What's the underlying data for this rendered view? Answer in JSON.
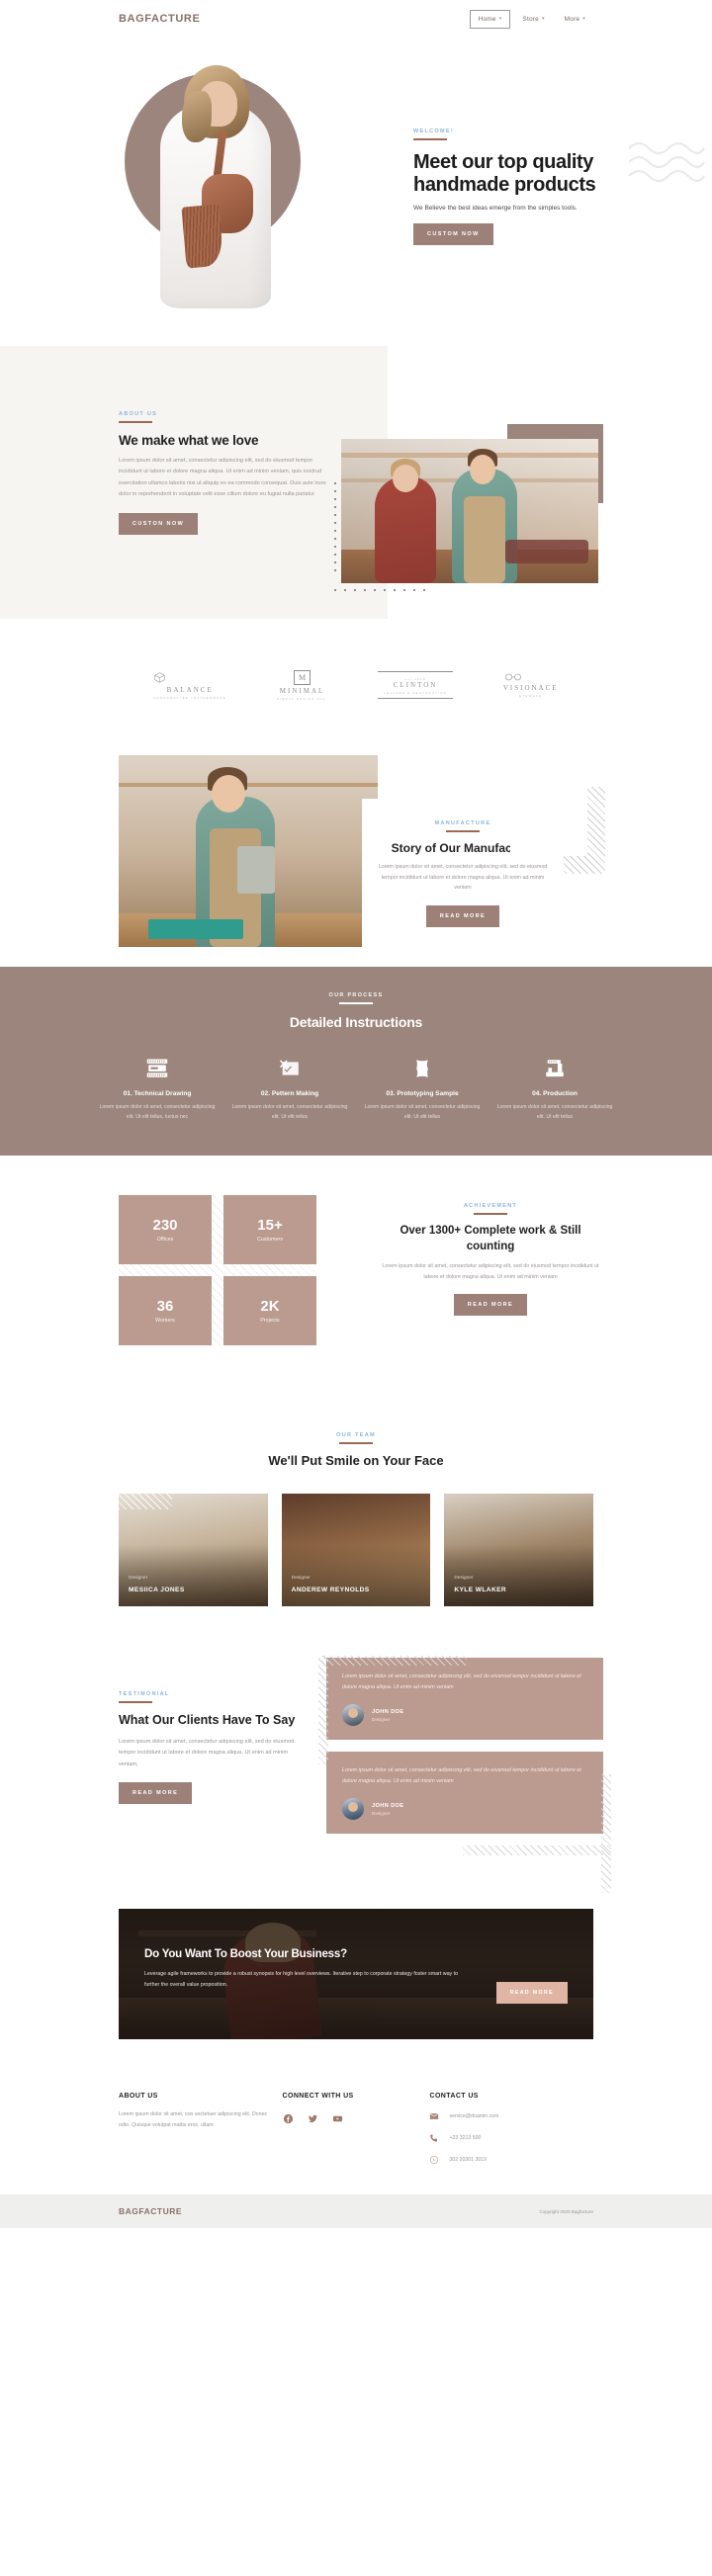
{
  "site": {
    "brand": "BAGFACTURE"
  },
  "header": {
    "nav": [
      {
        "label": "Home",
        "caret": "chevron-down-icon",
        "active": true
      },
      {
        "label": "Store",
        "caret": "chevron-down-icon",
        "active": false
      },
      {
        "label": "More",
        "caret": "chevron-down-icon",
        "active": false
      }
    ]
  },
  "hero": {
    "eyebrow": "WELCOME!",
    "title": "Meet our top quality handmade products",
    "subtitle": "We Believe the best ideas emerge from the simples tools.",
    "button": "CUSTOM NOW"
  },
  "about": {
    "eyebrow": "ABOUT US",
    "title": "We make what we love",
    "text": "Lorem ipsum dolor sit amet, consectetur adipiscing elit, sed do eiusmod tempor incididunt ut labore et dolore magna aliqua. Ut enim ad minim veniam, quis nostrud exercitation ullamco laboris nisi ut aliquip ex ea commodo consequat. Duis aute irure dolor in reprehenderit in voluptate velit esse cillum dolore eu fugiat nulla pariatur",
    "button": "CUSTON NOW"
  },
  "logos": [
    {
      "name": "BALANCE",
      "sub": "HANDCRAFTED LEATHERWARE",
      "mark": "cube-icon"
    },
    {
      "name": "MINIMAL",
      "sub": "SIMPLY DESIGN INC.",
      "mark": "m-monogram-icon"
    },
    {
      "name": "CLINTON",
      "sub": "LEATHER & RESTORATION",
      "mark": "est-2020"
    },
    {
      "name": "VISIONACE",
      "sub": "EYEWEAR",
      "mark": "glasses-icon"
    }
  ],
  "story": {
    "eyebrow": "MANUFACTURE",
    "title": "Story of Our Manufacture",
    "text": "Lorem ipsum dolor sit amet, consectetur adipiscing elit, sed do eiusmod tempor incididunt ut labore et dolore magna aliqua. Ut enim ad minim veniam",
    "button": "READ MORE"
  },
  "process": {
    "eyebrow": "OUR PROCESS",
    "title": "Detailed Instructions",
    "steps": [
      {
        "icon": "ruler-drawing-icon",
        "title": "01. Technical Drawing",
        "text": "Lorem ipsum dolor sit amet, consectetur adipiscing elit. Ut elit tellus, luctus nec"
      },
      {
        "icon": "pattern-cut-icon",
        "title": "02. Pettern Making",
        "text": "Lorem ipsum dolor sit amet, consectetur adipiscing elit. Ut elit tellus"
      },
      {
        "icon": "leather-piece-icon",
        "title": "03. Prototyping Sample",
        "text": "Lorem ipsum dolor sit amet, consectetur adipiscing elit. Ut elit tellus"
      },
      {
        "icon": "sewing-machine-icon",
        "title": "04. Production",
        "text": "Lorem ipsum dolor sit amet, consectetur adipiscing elit. Ut elit tellus"
      }
    ]
  },
  "achievement": {
    "eyebrow": "ACHIEVEMENT",
    "title": "Over 1300+ Complete work & Still counting",
    "text": "Lorem ipsum dolor sit amet, consectetur adipiscing elit, sed do eiusmod tempor incididunt ut labore et dolore magna aliqua. Ut enim ad minim veniam",
    "button": "READ MORE",
    "stats": [
      {
        "value": "230",
        "label": "Offices"
      },
      {
        "value": "15+",
        "label": "Customers"
      },
      {
        "value": "36",
        "label": "Workers"
      },
      {
        "value": "2K",
        "label": "Projects"
      }
    ]
  },
  "team": {
    "eyebrow": "OUR TEAM",
    "title": "We'll Put Smile on Your Face",
    "members": [
      {
        "name": "MESIICA JONES",
        "role": "Designer"
      },
      {
        "name": "ANDEREW REYNOLDS",
        "role": "Designer"
      },
      {
        "name": "KYLE WLAKER",
        "role": "Designer"
      }
    ]
  },
  "testimonial": {
    "eyebrow": "TESTIMONIAL",
    "title": "What Our Clients Have To Say",
    "text": "Lorem ipsum dolor sit amet, consectetur adipiscing elit, sed do eiusmod tempor incididunt ut labore et dolore magna aliqua. Ut enim ad minim veniam,",
    "button": "READ MORE",
    "cards": [
      {
        "quote": "Lorem ipsum dolor sit amet, consectetur adipiscing elit, sed do eiusmod tempor incididunt ut labore et dolore magna aliqua. Ut enim ad minim veniam",
        "name": "JOHN DOE",
        "role": "Designer"
      },
      {
        "quote": "Lorem ipsum dolor sit amet, consectetur adipiscing elit, sed do eiusmod tempor incididunt ut labore et dolore magna aliqua. Ut enim ad minim veniam",
        "name": "JOHN DOE",
        "role": "Designer"
      }
    ]
  },
  "cta": {
    "title": "Do You Want To Boost Your Business?",
    "text": "Leverage agile frameworks to provide a robust synopsis for high level overviews. Iterative step to corporate strategy foster smart way to further the overall value proposition.",
    "button": "READ MORE"
  },
  "footer": {
    "about": {
      "title": "ABOUT US",
      "text": "Lorem ipsum dolor sit amet, con sectetuer adipiscing elit. Donec odio. Quisque volutpat mattis eros. ullam"
    },
    "connect": {
      "title": "CONNECT WITH US",
      "socials": [
        {
          "name": "facebook-icon"
        },
        {
          "name": "twitter-icon"
        },
        {
          "name": "youtube-icon"
        }
      ]
    },
    "contact": {
      "title": "CONTACT US",
      "items": [
        {
          "icon": "mail-icon",
          "value": "service@doamin.com"
        },
        {
          "icon": "phone-icon",
          "value": "+23 3213 500"
        },
        {
          "icon": "whatsapp-icon",
          "value": "302 20301 3019"
        }
      ]
    },
    "bottom": {
      "brand": "BAGFACTURE",
      "copyright": "Copyright 2020 Bagfacture"
    }
  },
  "colors": {
    "accent": "#9b6a55",
    "brand": "#8a7068",
    "process_bg": "#9c857c",
    "stat_bg": "#bb9a90",
    "eyebrow": "#8ab6da",
    "cta_btn": "#e0b5a4"
  }
}
